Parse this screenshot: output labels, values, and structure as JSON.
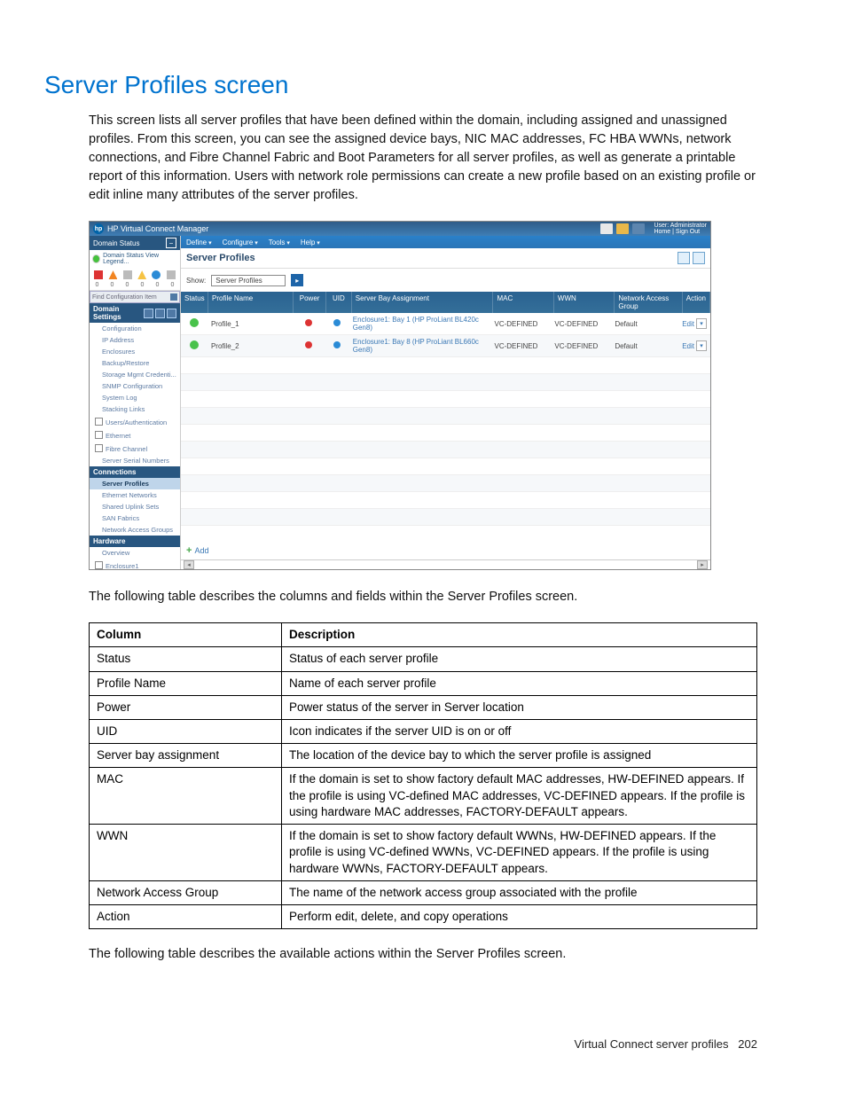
{
  "doc": {
    "title": "Server Profiles screen",
    "intro": "This screen lists all server profiles that have been defined within the domain, including assigned and unassigned profiles. From this screen, you can see the assigned device bays, NIC MAC addresses, FC HBA WWNs, network connections, and Fibre Channel Fabric and Boot Parameters for all server profiles, as well as generate a printable report of this information. Users with network role permissions can create a new profile based on an existing profile or edit inline many attributes of the server profiles.",
    "table_intro": "The following table describes the columns and fields within the Server Profiles screen.",
    "actions_intro": "The following table describes the available actions within the Server Profiles screen.",
    "table_headers": {
      "c1": "Column",
      "c2": "Description"
    },
    "rows": [
      {
        "c1": "Status",
        "c2": "Status of each server profile"
      },
      {
        "c1": "Profile Name",
        "c2": "Name of each server profile"
      },
      {
        "c1": "Power",
        "c2": "Power status of the server in Server location"
      },
      {
        "c1": "UID",
        "c2": "Icon indicates if the server UID is on or off"
      },
      {
        "c1": "Server bay assignment",
        "c2": "The location of the device bay to which the server profile is assigned"
      },
      {
        "c1": "MAC",
        "c2": "If the domain is set to show factory default MAC addresses, HW-DEFINED appears. If the profile is using VC-defined MAC addresses, VC-DEFINED appears. If the profile is using hardware MAC addresses, FACTORY-DEFAULT appears."
      },
      {
        "c1": "WWN",
        "c2": "If the domain is set to show factory default WWNs, HW-DEFINED appears. If the profile is using VC-defined WWNs, VC-DEFINED appears. If the profile is using hardware WWNs, FACTORY-DEFAULT appears."
      },
      {
        "c1": "Network Access Group",
        "c2": "The name of the network access group associated with the profile"
      },
      {
        "c1": "Action",
        "c2": "Perform edit, delete, and copy operations"
      }
    ],
    "footer": {
      "section": "Virtual Connect server profiles",
      "page": "202"
    }
  },
  "app": {
    "brand": "HP Virtual Connect Manager",
    "user": {
      "role": "User: Administrator",
      "links": "Home | Sign Out"
    },
    "menubar": [
      "Define",
      "Configure",
      "Tools",
      "Help"
    ],
    "sidebar": {
      "domainStatus": "Domain Status",
      "statusLine": "Domain Status   View Legend...",
      "counts": [
        "0",
        "0",
        "0",
        "0",
        "0",
        "0"
      ],
      "findPlaceholder": "Find Configuration Item",
      "domainSettings": "Domain Settings",
      "settingsItems": [
        "Configuration",
        "IP Address",
        "Enclosures",
        "Backup/Restore",
        "Storage Mgmt Credenti...",
        "SNMP Configuration",
        "System Log",
        "Stacking Links"
      ],
      "parentItems": [
        "Users/Authentication",
        "Ethernet",
        "Fibre Channel",
        "Server Serial Numbers"
      ],
      "connections": "Connections",
      "connItems": [
        "Server Profiles",
        "Ethernet Networks",
        "Shared Uplink Sets",
        "SAN Fabrics",
        "Network Access Groups"
      ],
      "hardware": "Hardware",
      "hwItems": [
        "Overview",
        "Enclosure1"
      ]
    },
    "main": {
      "panelTitle": "Server Profiles",
      "showLabel": "Show:",
      "showValue": "Server Profiles",
      "columns": {
        "status": "Status",
        "name": "Profile Name",
        "power": "Power",
        "uid": "UID",
        "bay": "Server Bay Assignment",
        "mac": "MAC",
        "wwn": "WWN",
        "nag": "Network Access Group",
        "action": "Action"
      },
      "rows": [
        {
          "name": "Profile_1",
          "bay": "Enclosure1: Bay 1 (HP ProLiant BL420c Gen8)",
          "mac": "VC-DEFINED",
          "wwn": "VC-DEFINED",
          "nag": "Default",
          "action": "Edit"
        },
        {
          "name": "Profile_2",
          "bay": "Enclosure1: Bay 8 (HP ProLiant BL660c Gen8)",
          "mac": "VC-DEFINED",
          "wwn": "VC-DEFINED",
          "nag": "Default",
          "action": "Edit"
        }
      ],
      "addLabel": "Add"
    }
  }
}
